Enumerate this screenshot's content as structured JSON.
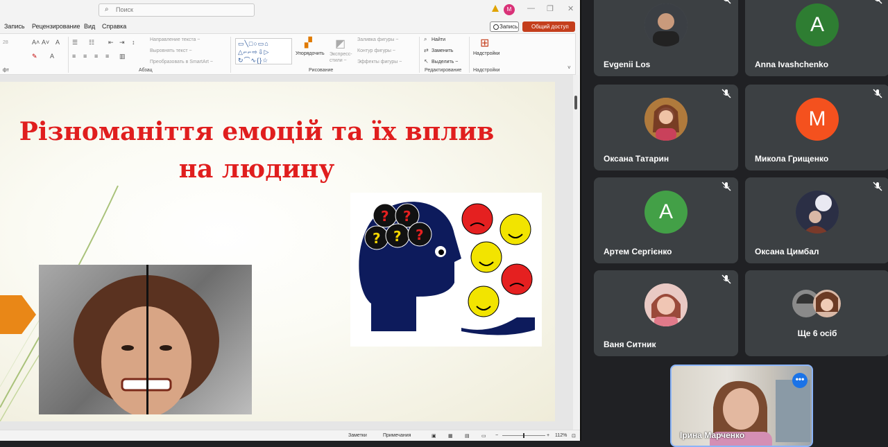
{
  "ppt": {
    "search_placeholder": "Поиск",
    "user_initial": "M",
    "menu": [
      "Запись",
      "Рецензирование",
      "Вид",
      "Справка"
    ],
    "record_button": "Запись",
    "share_button": "Общий доступ",
    "ribbon": {
      "paragraph_label": "Абзац",
      "font_label": "фт",
      "text_direction": "Направление текста ~",
      "align_text": "Выровнять текст ~",
      "smartart": "Преобразовать в SmartArt ~",
      "arrange": "Упорядочить",
      "quick_styles": "Экспресс-стили ~",
      "shape_fill": "Заливка фигуры ~",
      "shape_outline": "Контур фигуры ~",
      "shape_effects": "Эффекты фигуры ~",
      "drawing_label": "Рисование",
      "find": "Найти",
      "replace": "Заменить",
      "select": "Выделить ~",
      "editing_label": "Редактирование",
      "addins": "Надстройки",
      "addins_label": "Надстройки",
      "font_size": "28"
    },
    "slide": {
      "title_line1": "Різноманіття емоцій та їх вплив",
      "title_line2": "на людину",
      "accent_color": "#e01e1e",
      "arrow_color": "#e98717"
    },
    "status": {
      "notes": "Заметки",
      "comments": "Примечания",
      "zoom": "112%"
    }
  },
  "meet": {
    "participants": [
      {
        "name": "Evgenii Los",
        "initial": "",
        "color": "#5f6368"
      },
      {
        "name": "Anna Ivashchenko",
        "initial": "A",
        "color": "#2e7d32"
      },
      {
        "name": "Оксана Татарин",
        "initial": "",
        "color": "#8d6e63"
      },
      {
        "name": "Микола Грищенко",
        "initial": "M",
        "color": "#f4511e"
      },
      {
        "name": "Артем Сергієнко",
        "initial": "A",
        "color": "#43a047"
      },
      {
        "name": "Оксана Цимбал",
        "initial": "",
        "color": "#455a64"
      },
      {
        "name": "Ваня Ситник",
        "initial": "",
        "color": "#d7a9a0"
      }
    ],
    "more": "Ще 6 осіб",
    "self_name": "Ірина Марченко"
  }
}
